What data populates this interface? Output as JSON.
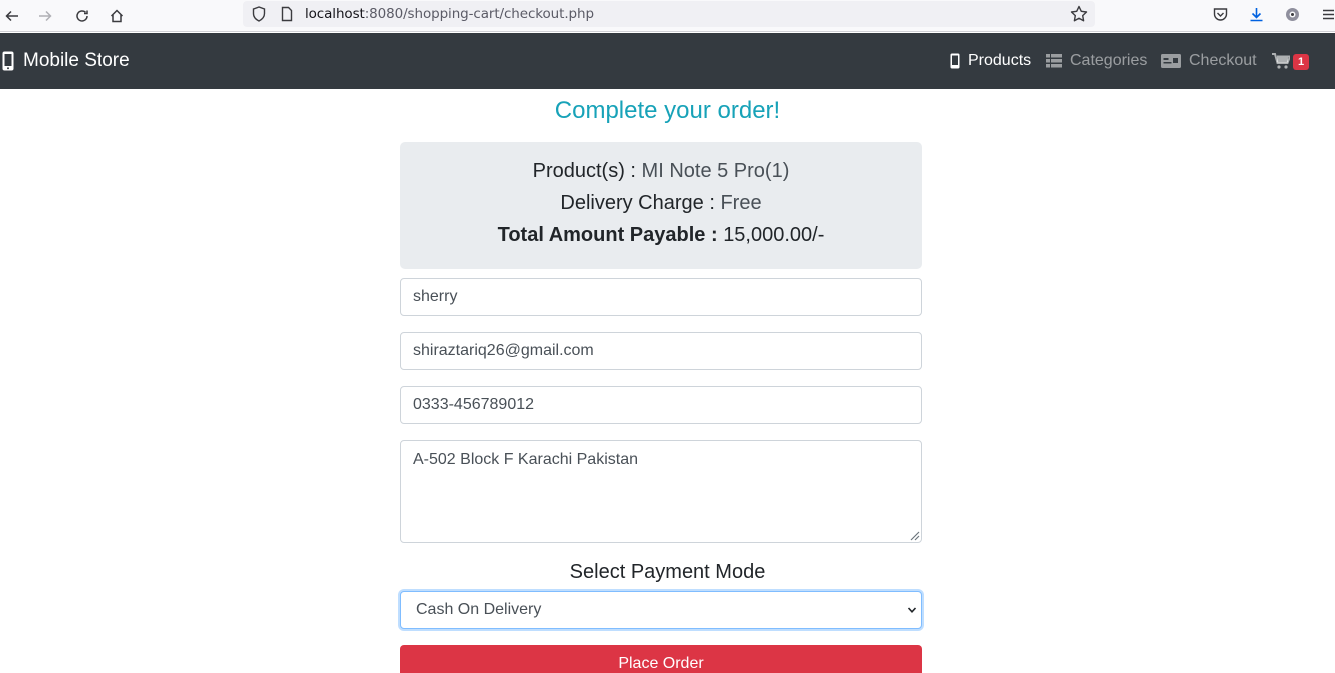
{
  "browser": {
    "url_host": "localhost",
    "url_rest": ":8080/shopping-cart/checkout.php"
  },
  "navbar": {
    "brand": "Mobile Store",
    "items": [
      {
        "label": "Products",
        "icon": "mobile-icon",
        "active": true
      },
      {
        "label": "Categories",
        "icon": "list-icon",
        "active": false
      },
      {
        "label": "Checkout",
        "icon": "card-icon",
        "active": false
      }
    ],
    "cart_count": "1"
  },
  "main": {
    "heading": "Complete your order!",
    "summary": {
      "products_label": "Product(s) :",
      "products_value": "MI Note 5 Pro(1)",
      "delivery_label": "Delivery Charge :",
      "delivery_value": "Free",
      "total_label": "Total Amount Payable :",
      "total_value": "15,000.00/-"
    },
    "form": {
      "name": "sherry",
      "email": "shiraztariq26@gmail.com",
      "phone": "0333-456789012",
      "address": "A-502 Block F Karachi Pakistan"
    },
    "payment": {
      "label": "Select Payment Mode",
      "selected": "Cash On Delivery"
    },
    "submit_label": "Place Order"
  },
  "colors": {
    "navbar_bg": "#343a40",
    "heading": "#17a2b8",
    "summary_bg": "#e9ecef",
    "danger": "#dc3545"
  }
}
